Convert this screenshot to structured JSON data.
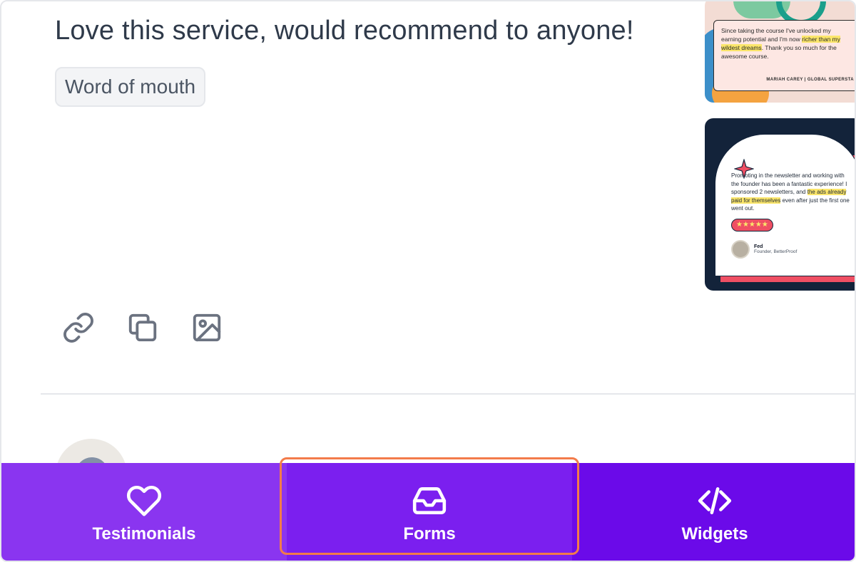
{
  "testimonial": {
    "quote": "Love this service, would recommend to anyone!",
    "tag": "Word of mouth"
  },
  "actions": [
    {
      "name": "link-icon"
    },
    {
      "name": "copy-icon"
    },
    {
      "name": "image-icon"
    }
  ],
  "thumbnails": {
    "first": {
      "text_start": "Since taking the course I've unlocked my earning potential and I'm now ",
      "text_highlight": "richer than my wildest dreams",
      "text_end": ". Thank you so much for the awesome course.",
      "signature": "MARIAH CAREY | GLOBAL SUPERSTA"
    },
    "second": {
      "text_start": "Promoting in the newsletter and working with the founder has been a fantastic experience! I sponsored 2 newsletters, and ",
      "text_highlight": "the ads already paid for themselves",
      "text_end": " even after just the first one went out.",
      "stars": "★★★★★",
      "person_name": "Fed",
      "person_role": "Founder, BetterProof"
    }
  },
  "bottom_nav": {
    "testimonials": "Testimonials",
    "forms": "Forms",
    "widgets": "Widgets"
  },
  "colors": {
    "nav_testimonials": "#8a35f0",
    "nav_forms": "#7b1fef",
    "nav_widgets": "#6b0ae9",
    "highlight_border": "#f37b4a"
  }
}
